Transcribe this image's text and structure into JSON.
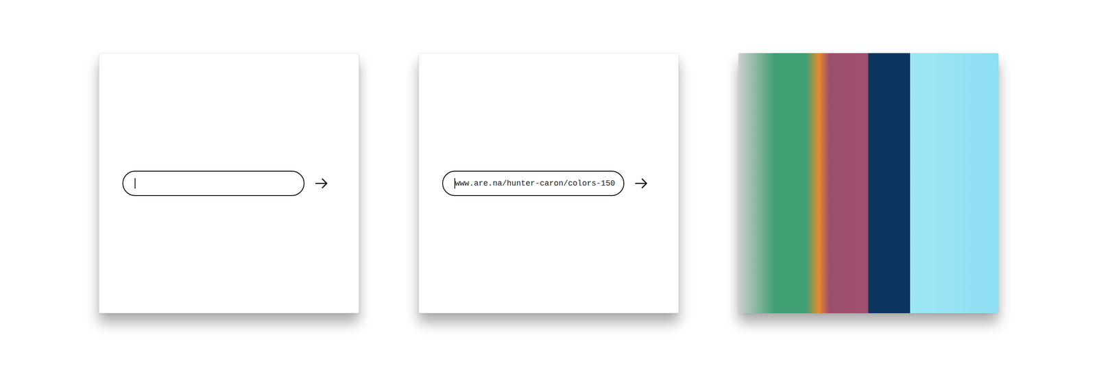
{
  "cards": [
    {
      "kind": "input",
      "value": "",
      "focused": true
    },
    {
      "kind": "input",
      "value": "www.are.na/hunter-caron/colors-150",
      "focused": true
    },
    {
      "kind": "image"
    }
  ]
}
